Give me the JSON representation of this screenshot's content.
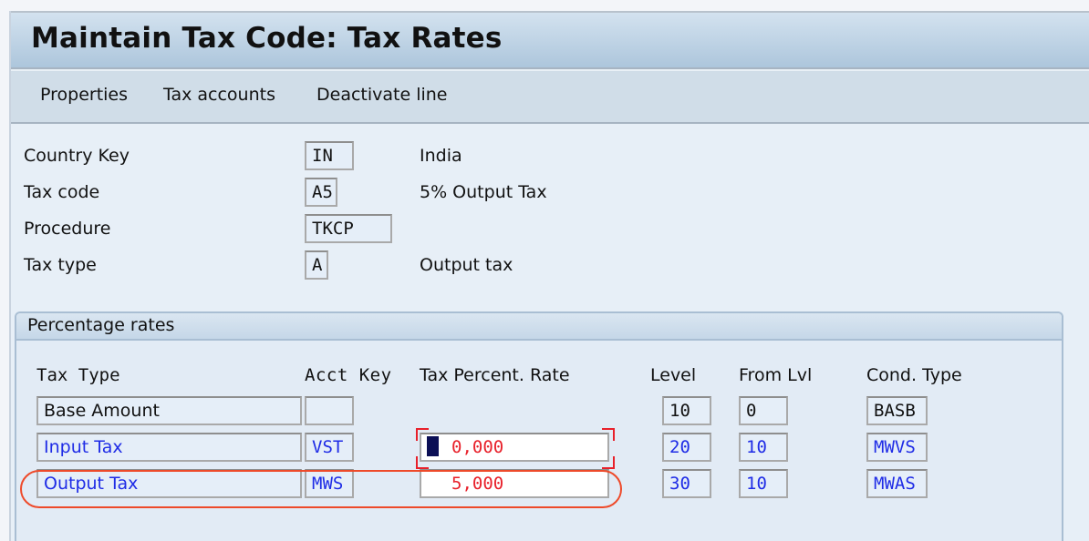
{
  "window": {
    "title": "Maintain Tax Code: Tax Rates"
  },
  "toolbar": {
    "buttons": [
      "Properties",
      "Tax accounts",
      "Deactivate line"
    ]
  },
  "header_fields": [
    {
      "label": "Country Key",
      "value": "IN",
      "description": "India"
    },
    {
      "label": "Tax code",
      "value": "A5",
      "description": "5% Output Tax"
    },
    {
      "label": "Procedure",
      "value": "TKCP",
      "description": ""
    },
    {
      "label": "Tax type",
      "value": "A",
      "description": "Output tax"
    }
  ],
  "percentage_rates": {
    "title": "Percentage rates",
    "columns": [
      "Tax Type",
      "Acct Key",
      "Tax Percent. Rate",
      "Level",
      "From Lvl",
      "Cond. Type"
    ],
    "rows": [
      {
        "tax_type": "Base Amount",
        "acct_key": "",
        "rate": "",
        "level": "10",
        "from_lvl": "0",
        "cond_type": "BASB"
      },
      {
        "tax_type": "Input Tax",
        "acct_key": "VST",
        "rate": "0,000",
        "level": "20",
        "from_lvl": "10",
        "cond_type": "MWVS"
      },
      {
        "tax_type": "Output Tax",
        "acct_key": "MWS",
        "rate": "5,000",
        "level": "30",
        "from_lvl": "10",
        "cond_type": "MWAS"
      }
    ]
  },
  "colors": {
    "link_blue": "#1f2ce6",
    "rate_red": "#e8202a",
    "highlight_red": "#ee4a2a"
  }
}
